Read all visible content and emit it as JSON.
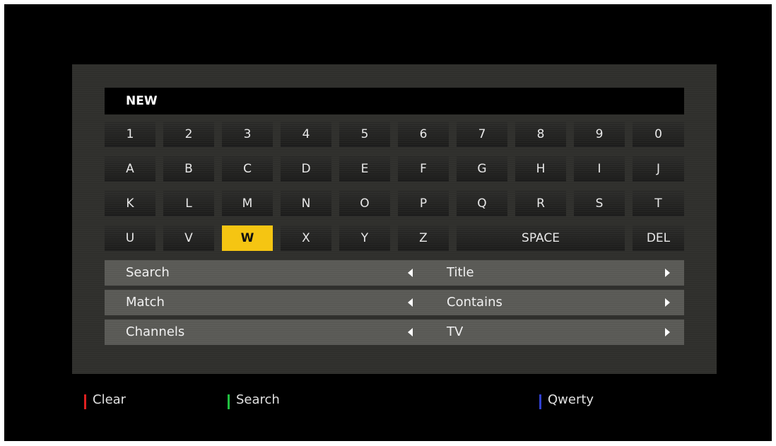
{
  "input": {
    "value": "NEW"
  },
  "keyboard": {
    "rows": [
      [
        "1",
        "2",
        "3",
        "4",
        "5",
        "6",
        "7",
        "8",
        "9",
        "0"
      ],
      [
        "A",
        "B",
        "C",
        "D",
        "E",
        "F",
        "G",
        "H",
        "I",
        "J"
      ],
      [
        "K",
        "L",
        "M",
        "N",
        "O",
        "P",
        "Q",
        "R",
        "S",
        "T"
      ],
      [
        "U",
        "V",
        "W",
        "X",
        "Y",
        "Z",
        "SPACE",
        "DEL"
      ]
    ],
    "selected": "W"
  },
  "options": [
    {
      "label": "Search",
      "value": "Title"
    },
    {
      "label": "Match",
      "value": "Contains"
    },
    {
      "label": "Channels",
      "value": "TV"
    }
  ],
  "hints": [
    {
      "label": "Clear",
      "color": "#e02020"
    },
    {
      "label": "Search",
      "color": "#20c040"
    },
    {
      "label": "Qwerty",
      "color": "#3040d0"
    }
  ]
}
